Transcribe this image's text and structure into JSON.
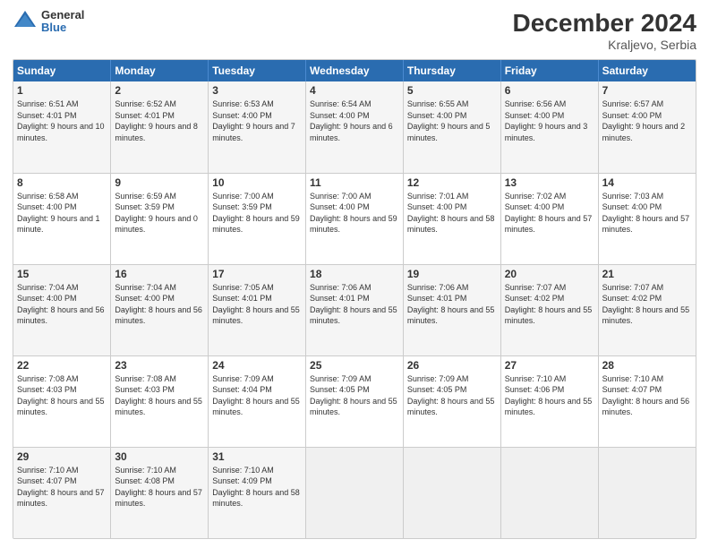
{
  "logo": {
    "general": "General",
    "blue": "Blue"
  },
  "header": {
    "title": "December 2024",
    "location": "Kraljevo, Serbia"
  },
  "days_of_week": [
    "Sunday",
    "Monday",
    "Tuesday",
    "Wednesday",
    "Thursday",
    "Friday",
    "Saturday"
  ],
  "weeks": [
    [
      {
        "num": "1",
        "sunrise": "Sunrise: 6:51 AM",
        "sunset": "Sunset: 4:01 PM",
        "daylight": "Daylight: 9 hours and 10 minutes."
      },
      {
        "num": "2",
        "sunrise": "Sunrise: 6:52 AM",
        "sunset": "Sunset: 4:01 PM",
        "daylight": "Daylight: 9 hours and 8 minutes."
      },
      {
        "num": "3",
        "sunrise": "Sunrise: 6:53 AM",
        "sunset": "Sunset: 4:00 PM",
        "daylight": "Daylight: 9 hours and 7 minutes."
      },
      {
        "num": "4",
        "sunrise": "Sunrise: 6:54 AM",
        "sunset": "Sunset: 4:00 PM",
        "daylight": "Daylight: 9 hours and 6 minutes."
      },
      {
        "num": "5",
        "sunrise": "Sunrise: 6:55 AM",
        "sunset": "Sunset: 4:00 PM",
        "daylight": "Daylight: 9 hours and 5 minutes."
      },
      {
        "num": "6",
        "sunrise": "Sunrise: 6:56 AM",
        "sunset": "Sunset: 4:00 PM",
        "daylight": "Daylight: 9 hours and 3 minutes."
      },
      {
        "num": "7",
        "sunrise": "Sunrise: 6:57 AM",
        "sunset": "Sunset: 4:00 PM",
        "daylight": "Daylight: 9 hours and 2 minutes."
      }
    ],
    [
      {
        "num": "8",
        "sunrise": "Sunrise: 6:58 AM",
        "sunset": "Sunset: 4:00 PM",
        "daylight": "Daylight: 9 hours and 1 minute."
      },
      {
        "num": "9",
        "sunrise": "Sunrise: 6:59 AM",
        "sunset": "Sunset: 3:59 PM",
        "daylight": "Daylight: 9 hours and 0 minutes."
      },
      {
        "num": "10",
        "sunrise": "Sunrise: 7:00 AM",
        "sunset": "Sunset: 3:59 PM",
        "daylight": "Daylight: 8 hours and 59 minutes."
      },
      {
        "num": "11",
        "sunrise": "Sunrise: 7:00 AM",
        "sunset": "Sunset: 4:00 PM",
        "daylight": "Daylight: 8 hours and 59 minutes."
      },
      {
        "num": "12",
        "sunrise": "Sunrise: 7:01 AM",
        "sunset": "Sunset: 4:00 PM",
        "daylight": "Daylight: 8 hours and 58 minutes."
      },
      {
        "num": "13",
        "sunrise": "Sunrise: 7:02 AM",
        "sunset": "Sunset: 4:00 PM",
        "daylight": "Daylight: 8 hours and 57 minutes."
      },
      {
        "num": "14",
        "sunrise": "Sunrise: 7:03 AM",
        "sunset": "Sunset: 4:00 PM",
        "daylight": "Daylight: 8 hours and 57 minutes."
      }
    ],
    [
      {
        "num": "15",
        "sunrise": "Sunrise: 7:04 AM",
        "sunset": "Sunset: 4:00 PM",
        "daylight": "Daylight: 8 hours and 56 minutes."
      },
      {
        "num": "16",
        "sunrise": "Sunrise: 7:04 AM",
        "sunset": "Sunset: 4:00 PM",
        "daylight": "Daylight: 8 hours and 56 minutes."
      },
      {
        "num": "17",
        "sunrise": "Sunrise: 7:05 AM",
        "sunset": "Sunset: 4:01 PM",
        "daylight": "Daylight: 8 hours and 55 minutes."
      },
      {
        "num": "18",
        "sunrise": "Sunrise: 7:06 AM",
        "sunset": "Sunset: 4:01 PM",
        "daylight": "Daylight: 8 hours and 55 minutes."
      },
      {
        "num": "19",
        "sunrise": "Sunrise: 7:06 AM",
        "sunset": "Sunset: 4:01 PM",
        "daylight": "Daylight: 8 hours and 55 minutes."
      },
      {
        "num": "20",
        "sunrise": "Sunrise: 7:07 AM",
        "sunset": "Sunset: 4:02 PM",
        "daylight": "Daylight: 8 hours and 55 minutes."
      },
      {
        "num": "21",
        "sunrise": "Sunrise: 7:07 AM",
        "sunset": "Sunset: 4:02 PM",
        "daylight": "Daylight: 8 hours and 55 minutes."
      }
    ],
    [
      {
        "num": "22",
        "sunrise": "Sunrise: 7:08 AM",
        "sunset": "Sunset: 4:03 PM",
        "daylight": "Daylight: 8 hours and 55 minutes."
      },
      {
        "num": "23",
        "sunrise": "Sunrise: 7:08 AM",
        "sunset": "Sunset: 4:03 PM",
        "daylight": "Daylight: 8 hours and 55 minutes."
      },
      {
        "num": "24",
        "sunrise": "Sunrise: 7:09 AM",
        "sunset": "Sunset: 4:04 PM",
        "daylight": "Daylight: 8 hours and 55 minutes."
      },
      {
        "num": "25",
        "sunrise": "Sunrise: 7:09 AM",
        "sunset": "Sunset: 4:05 PM",
        "daylight": "Daylight: 8 hours and 55 minutes."
      },
      {
        "num": "26",
        "sunrise": "Sunrise: 7:09 AM",
        "sunset": "Sunset: 4:05 PM",
        "daylight": "Daylight: 8 hours and 55 minutes."
      },
      {
        "num": "27",
        "sunrise": "Sunrise: 7:10 AM",
        "sunset": "Sunset: 4:06 PM",
        "daylight": "Daylight: 8 hours and 55 minutes."
      },
      {
        "num": "28",
        "sunrise": "Sunrise: 7:10 AM",
        "sunset": "Sunset: 4:07 PM",
        "daylight": "Daylight: 8 hours and 56 minutes."
      }
    ],
    [
      {
        "num": "29",
        "sunrise": "Sunrise: 7:10 AM",
        "sunset": "Sunset: 4:07 PM",
        "daylight": "Daylight: 8 hours and 57 minutes."
      },
      {
        "num": "30",
        "sunrise": "Sunrise: 7:10 AM",
        "sunset": "Sunset: 4:08 PM",
        "daylight": "Daylight: 8 hours and 57 minutes."
      },
      {
        "num": "31",
        "sunrise": "Sunrise: 7:10 AM",
        "sunset": "Sunset: 4:09 PM",
        "daylight": "Daylight: 8 hours and 58 minutes."
      },
      null,
      null,
      null,
      null
    ]
  ]
}
